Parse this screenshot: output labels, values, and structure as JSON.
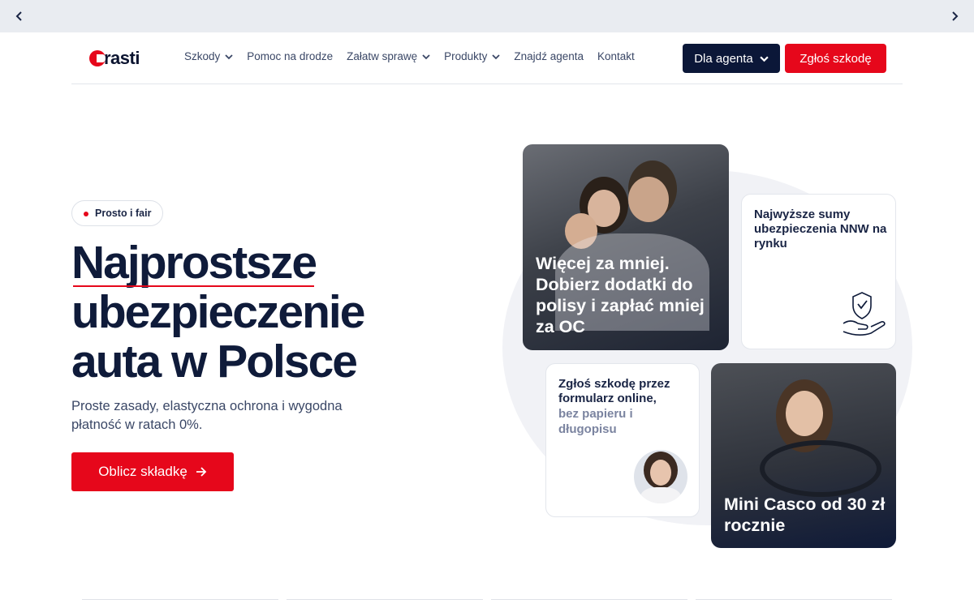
{
  "slider": {
    "prev_icon": "chevron-left-icon",
    "next_icon": "chevron-right-icon"
  },
  "brand": {
    "name": "rasti",
    "accent": "#e6071b",
    "navy": "#0b1738"
  },
  "nav": {
    "items": [
      {
        "label": "Szkody",
        "dropdown": true
      },
      {
        "label": "Pomoc na drodze",
        "dropdown": false
      },
      {
        "label": "Załatw sprawę",
        "dropdown": true
      },
      {
        "label": "Produkty",
        "dropdown": true
      },
      {
        "label": "Znajdź agenta",
        "dropdown": false
      },
      {
        "label": "Kontakt",
        "dropdown": false
      }
    ],
    "agent_button": "Dla agenta",
    "claim_button": "Zgłoś szkodę"
  },
  "hero": {
    "badge": "Prosto i fair",
    "headline_1": "Najprostsze",
    "headline_2": "ubezpieczenie",
    "headline_3": "auta w Polsce",
    "subtitle": "Proste zasady, elastyczna ochrona i wygodna płatność w ratach 0%.",
    "cta": "Oblicz składkę"
  },
  "cards": {
    "addons": "Więcej za mniej. Dobierz dodatki do polisy i zapłać mniej za OC",
    "nnw": "Najwyższe sumy ubezpieczenia NNW na rynku",
    "form_title": "Zgłoś szkodę przez formularz online,",
    "form_sub": "bez papieru i długopisu",
    "casco": "Mini Casco od 30 zł rocznie"
  }
}
